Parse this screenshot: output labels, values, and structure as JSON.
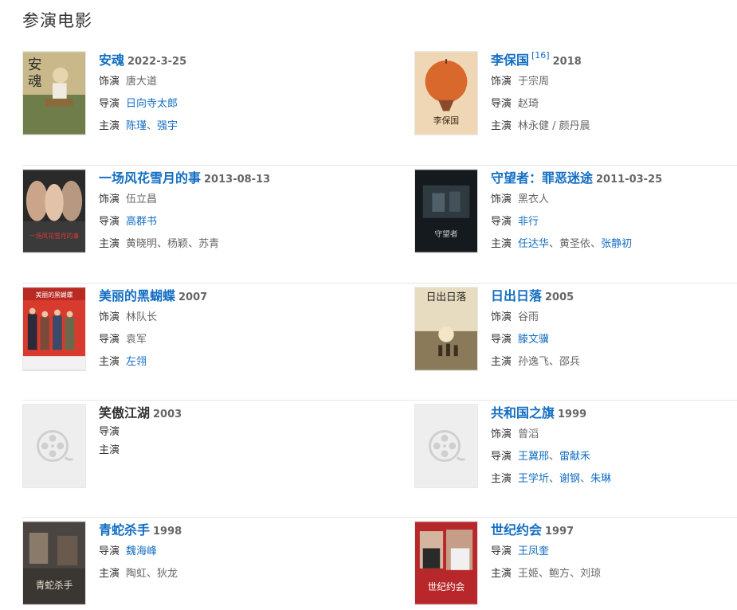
{
  "section_title": "参演电影",
  "labels": {
    "role": "饰演",
    "director": "导演",
    "cast": "主演"
  },
  "films": [
    {
      "title": "安魂",
      "sup": "",
      "year": "2022-3-25",
      "title_link": true,
      "role": "唐大道",
      "director": [
        {
          "name": "日向寺太郎",
          "link": true
        }
      ],
      "cast": [
        {
          "name": "陈瑾",
          "link": true
        },
        {
          "name": "强宇",
          "link": true
        }
      ],
      "poster": "anhun"
    },
    {
      "title": "李保国",
      "sup": "[16]",
      "year": "2018",
      "title_link": true,
      "role": "于宗周",
      "director": [
        {
          "name": "赵琦",
          "link": false
        }
      ],
      "cast": [
        {
          "name": "林永健 / 颜丹晨",
          "link": false
        }
      ],
      "poster": "libaoguo"
    },
    {
      "title": "一场风花雪月的事",
      "sup": "",
      "year": "2013-08-13",
      "title_link": true,
      "role": "伍立昌",
      "director": [
        {
          "name": "高群书",
          "link": true
        }
      ],
      "cast": [
        {
          "name": "黄晓明",
          "link": false
        },
        {
          "name": "杨颖",
          "link": false
        },
        {
          "name": "苏青",
          "link": false
        }
      ],
      "poster": "fenghua"
    },
    {
      "title": "守望者：罪恶迷途",
      "sup": "",
      "year": "2011-03-25",
      "title_link": true,
      "role": "黑衣人",
      "director": [
        {
          "name": "非行",
          "link": true
        }
      ],
      "cast": [
        {
          "name": "任达华",
          "link": true
        },
        {
          "name": "黄圣依",
          "link": false
        },
        {
          "name": "张静初",
          "link": true
        }
      ],
      "poster": "shouwang"
    },
    {
      "title": "美丽的黑蝴蝶",
      "sup": "",
      "year": "2007",
      "title_link": true,
      "role": "林队长",
      "director": [
        {
          "name": "袁军",
          "link": false
        }
      ],
      "cast": [
        {
          "name": "左翎",
          "link": true
        }
      ],
      "poster": "hudie"
    },
    {
      "title": "日出日落",
      "sup": "",
      "year": "2005",
      "title_link": true,
      "role": "谷雨",
      "director": [
        {
          "name": "滕文骥",
          "link": true
        }
      ],
      "cast": [
        {
          "name": "孙逸飞",
          "link": false
        },
        {
          "name": "邵兵",
          "link": false
        }
      ],
      "poster": "richu"
    },
    {
      "title": "笑傲江湖",
      "sup": "",
      "year": "2003",
      "title_link": false,
      "role": "",
      "director": [],
      "cast": [],
      "poster": "placeholder"
    },
    {
      "title": "共和国之旗",
      "sup": "",
      "year": "1999",
      "title_link": true,
      "role": "曾滔",
      "director": [
        {
          "name": "王冀邢",
          "link": true
        },
        {
          "name": "雷献禾",
          "link": true
        }
      ],
      "cast": [
        {
          "name": "王学圻",
          "link": true
        },
        {
          "name": "谢钢",
          "link": true
        },
        {
          "name": "朱琳",
          "link": true
        }
      ],
      "poster": "placeholder"
    },
    {
      "title": "青蛇杀手",
      "sup": "",
      "year": "1998",
      "title_link": true,
      "role": "",
      "director": [
        {
          "name": "魏海峰",
          "link": true
        }
      ],
      "cast": [
        {
          "name": "陶虹",
          "link": false
        },
        {
          "name": "狄龙",
          "link": false
        }
      ],
      "poster": "qingshe"
    },
    {
      "title": "世纪约会",
      "sup": "",
      "year": "1997",
      "title_link": true,
      "role": "",
      "director": [
        {
          "name": "王凤奎",
          "link": true
        }
      ],
      "cast": [
        {
          "name": "王姬",
          "link": false
        },
        {
          "name": "鲍方",
          "link": false
        },
        {
          "name": "刘琼",
          "link": false
        }
      ],
      "poster": "shiji"
    }
  ],
  "poster_text": {
    "anhun": "安魂",
    "libaoguo": "李保国",
    "fenghua": "一场风花雪月的事",
    "shouwang": "守望者",
    "hudie": "美丽的黑蝴蝶",
    "richu": "日出日落",
    "qingshe": "青蛇杀手",
    "shiji": "世纪约会"
  }
}
